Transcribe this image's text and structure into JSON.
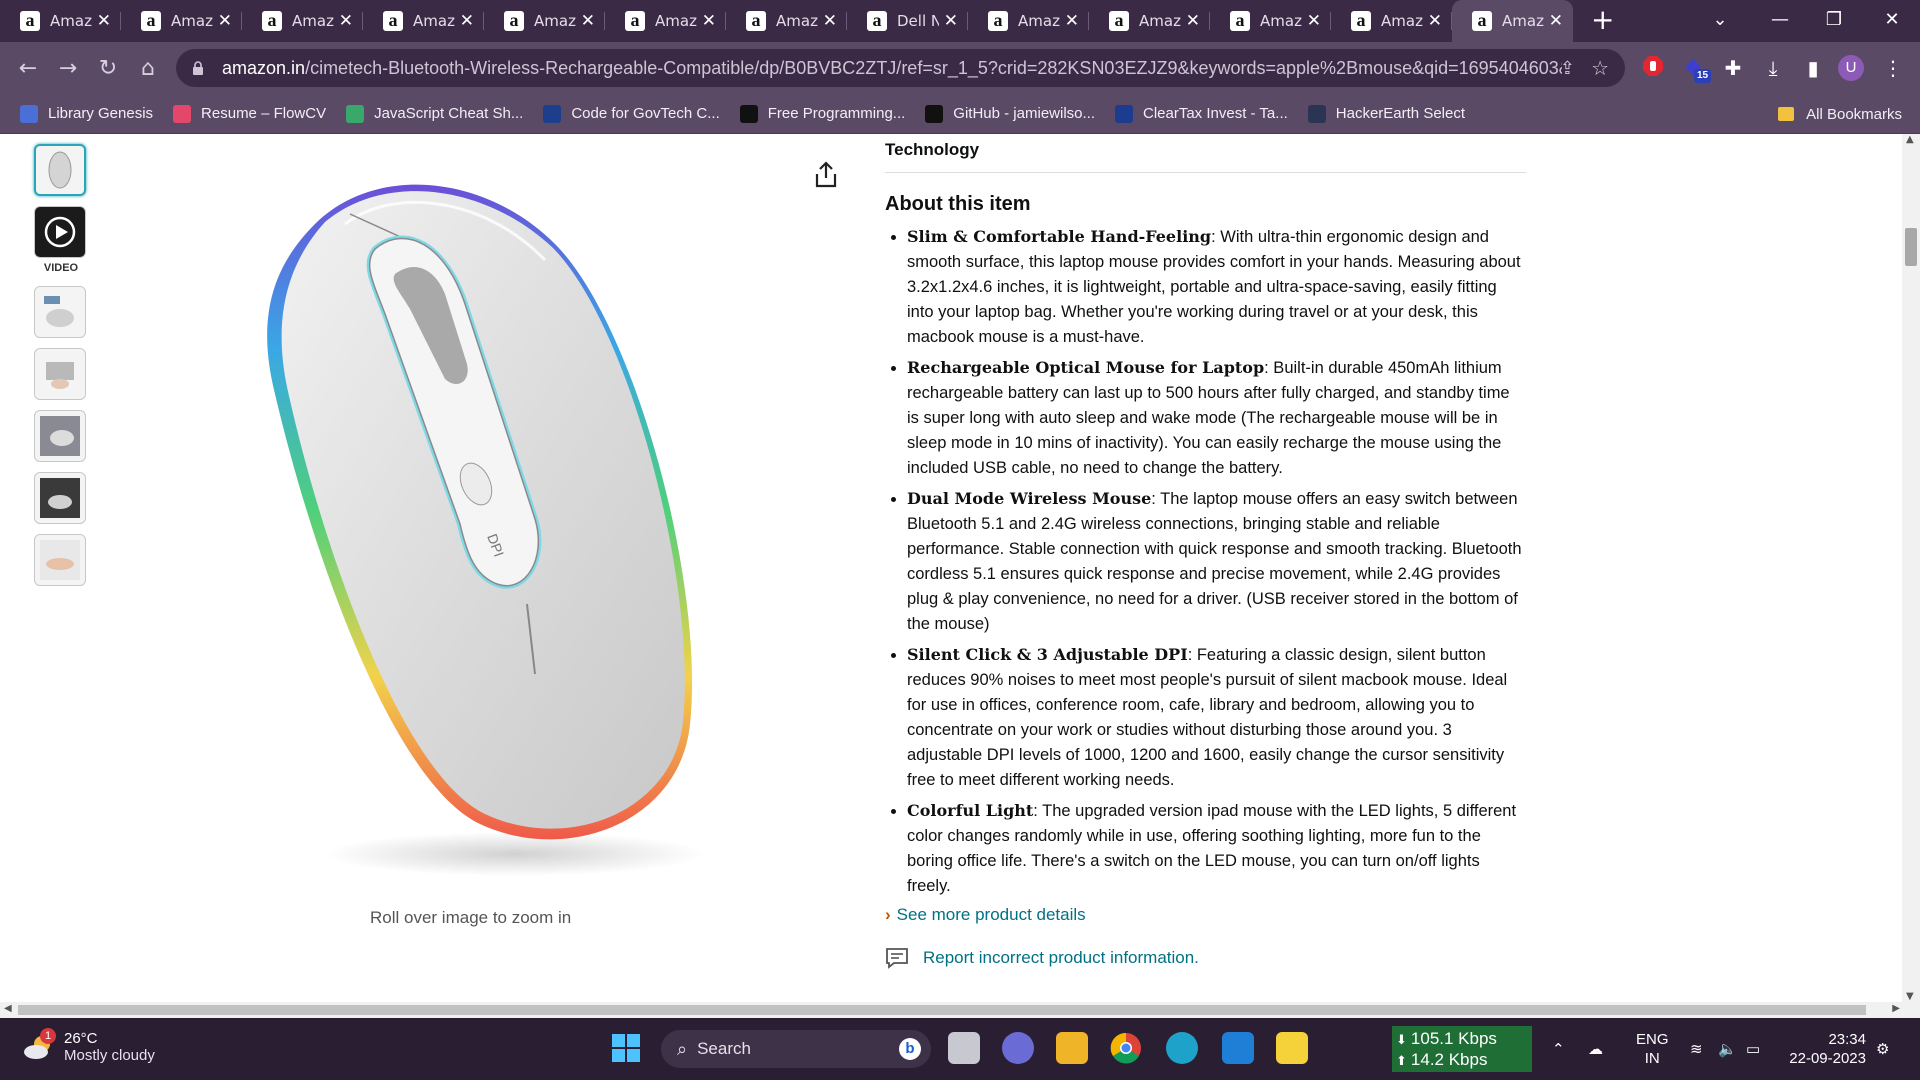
{
  "tabs": [
    {
      "title": "Amazon"
    },
    {
      "title": "Amazon"
    },
    {
      "title": "Amazon"
    },
    {
      "title": "Amazon"
    },
    {
      "title": "Amazon"
    },
    {
      "title": "Amazon"
    },
    {
      "title": "Amazon"
    },
    {
      "title": "Dell N"
    },
    {
      "title": "Amazon"
    },
    {
      "title": "Amazon"
    },
    {
      "title": "Amazon"
    },
    {
      "title": "Amazon"
    },
    {
      "title": "Amazon",
      "active": true
    }
  ],
  "browser": {
    "url_domain": "amazon.in",
    "url_path": "/cimetech-Bluetooth-Wireless-Rechargeable-Compatible/dp/B0BVBC2ZTJ/ref=sr_1_5?crid=282KSN03EZJZ9&keywords=apple%2Bmouse&qid=1695404603&s...",
    "extension_badge": "15",
    "profile_initial": "U"
  },
  "bookmarks": [
    {
      "label": "Library Genesis",
      "icon": "library-genesis-icon",
      "color": "#4a6fd6"
    },
    {
      "label": "Resume – FlowCV",
      "icon": "flowcv-icon",
      "color": "#e5476a"
    },
    {
      "label": "JavaScript Cheat Sh...",
      "icon": "js-cheatsheet-icon",
      "color": "#3aa86b"
    },
    {
      "label": "Code for GovTech C...",
      "icon": "unstop-icon",
      "color": "#1c3e8c"
    },
    {
      "label": "Free Programming...",
      "icon": "free-programming-icon",
      "color": "#111111"
    },
    {
      "label": "GitHub - jamiewilso...",
      "icon": "github-icon",
      "color": "#111111"
    },
    {
      "label": "ClearTax Invest - Ta...",
      "icon": "cleartax-icon",
      "color": "#1b3c8f"
    },
    {
      "label": "HackerEarth Select",
      "icon": "hackerearth-icon",
      "color": "#2c3454"
    }
  ],
  "all_bookmarks_label": "All Bookmarks",
  "product": {
    "video_label": "VIDEO",
    "zoom_hint": "Roll over image to zoom in",
    "section_prev": "Technology",
    "about_title": "About this item",
    "bullets": [
      {
        "bold": "Slim & Comfortable Hand-Feeling",
        "text": ": With ultra-thin ergonomic design and smooth surface, this laptop mouse provides comfort in your hands. Measuring about 3.2x1.2x4.6 inches, it is lightweight, portable and ultra-space-saving, easily fitting into your laptop bag. Whether you're working during travel or at your desk, this macbook mouse is a must-have."
      },
      {
        "bold": "Rechargeable Optical Mouse for Laptop",
        "text": ": Built-in durable 450mAh lithium rechargeable battery can last up to 500 hours after fully charged, and standby time is super long with auto sleep and wake mode (The rechargeable mouse will be in sleep mode in 10 mins of inactivity). You can easily recharge the mouse using the included USB cable, no need to change the battery."
      },
      {
        "bold": "Dual Mode Wireless Mouse",
        "text": ": The laptop mouse offers an easy switch between Bluetooth 5.1 and 2.4G wireless connections, bringing stable and reliable performance. Stable connection with quick response and smooth tracking. Bluetooth cordless 5.1 ensures quick response and precise movement, while 2.4G provides plug & play convenience, no need for a driver. (USB receiver stored in the bottom of the mouse)"
      },
      {
        "bold": "Silent Click & 3 Adjustable DPI",
        "text": ": Featuring a classic design, silent button reduces 90% noises to meet most people's pursuit of silent macbook mouse. Ideal for use in offices, conference room, cafe, library and bedroom, allowing you to concentrate on your work or studies without disturbing those around you. 3 adjustable DPI levels of 1000, 1200 and 1600, easily change the cursor sensitivity free to meet different working needs."
      },
      {
        "bold": "Colorful Light",
        "text": ": The upgraded version ipad mouse with the LED lights, 5 different color changes randomly while in use, offering soothing lighting, more fun to the boring office life. There's a switch on the LED mouse, you can turn on/off lights freely."
      }
    ],
    "see_more": "See more product details",
    "report": "Report incorrect product information.",
    "mouse_button_label": "DPI"
  },
  "taskbar": {
    "weather_badge": "1",
    "temperature": "26°C",
    "condition": "Mostly cloudy",
    "search_placeholder": "Search",
    "net_down": "105.1 Kbps",
    "net_up": "14.2 Kbps",
    "lang1": "ENG",
    "lang2": "IN",
    "time": "23:34",
    "date": "22-09-2023"
  },
  "colors": {
    "tab_bg": "#3b2a45",
    "toolbar_bg": "#5b4a66",
    "link": "#007185",
    "taskbar_bg": "#2a1e33"
  }
}
